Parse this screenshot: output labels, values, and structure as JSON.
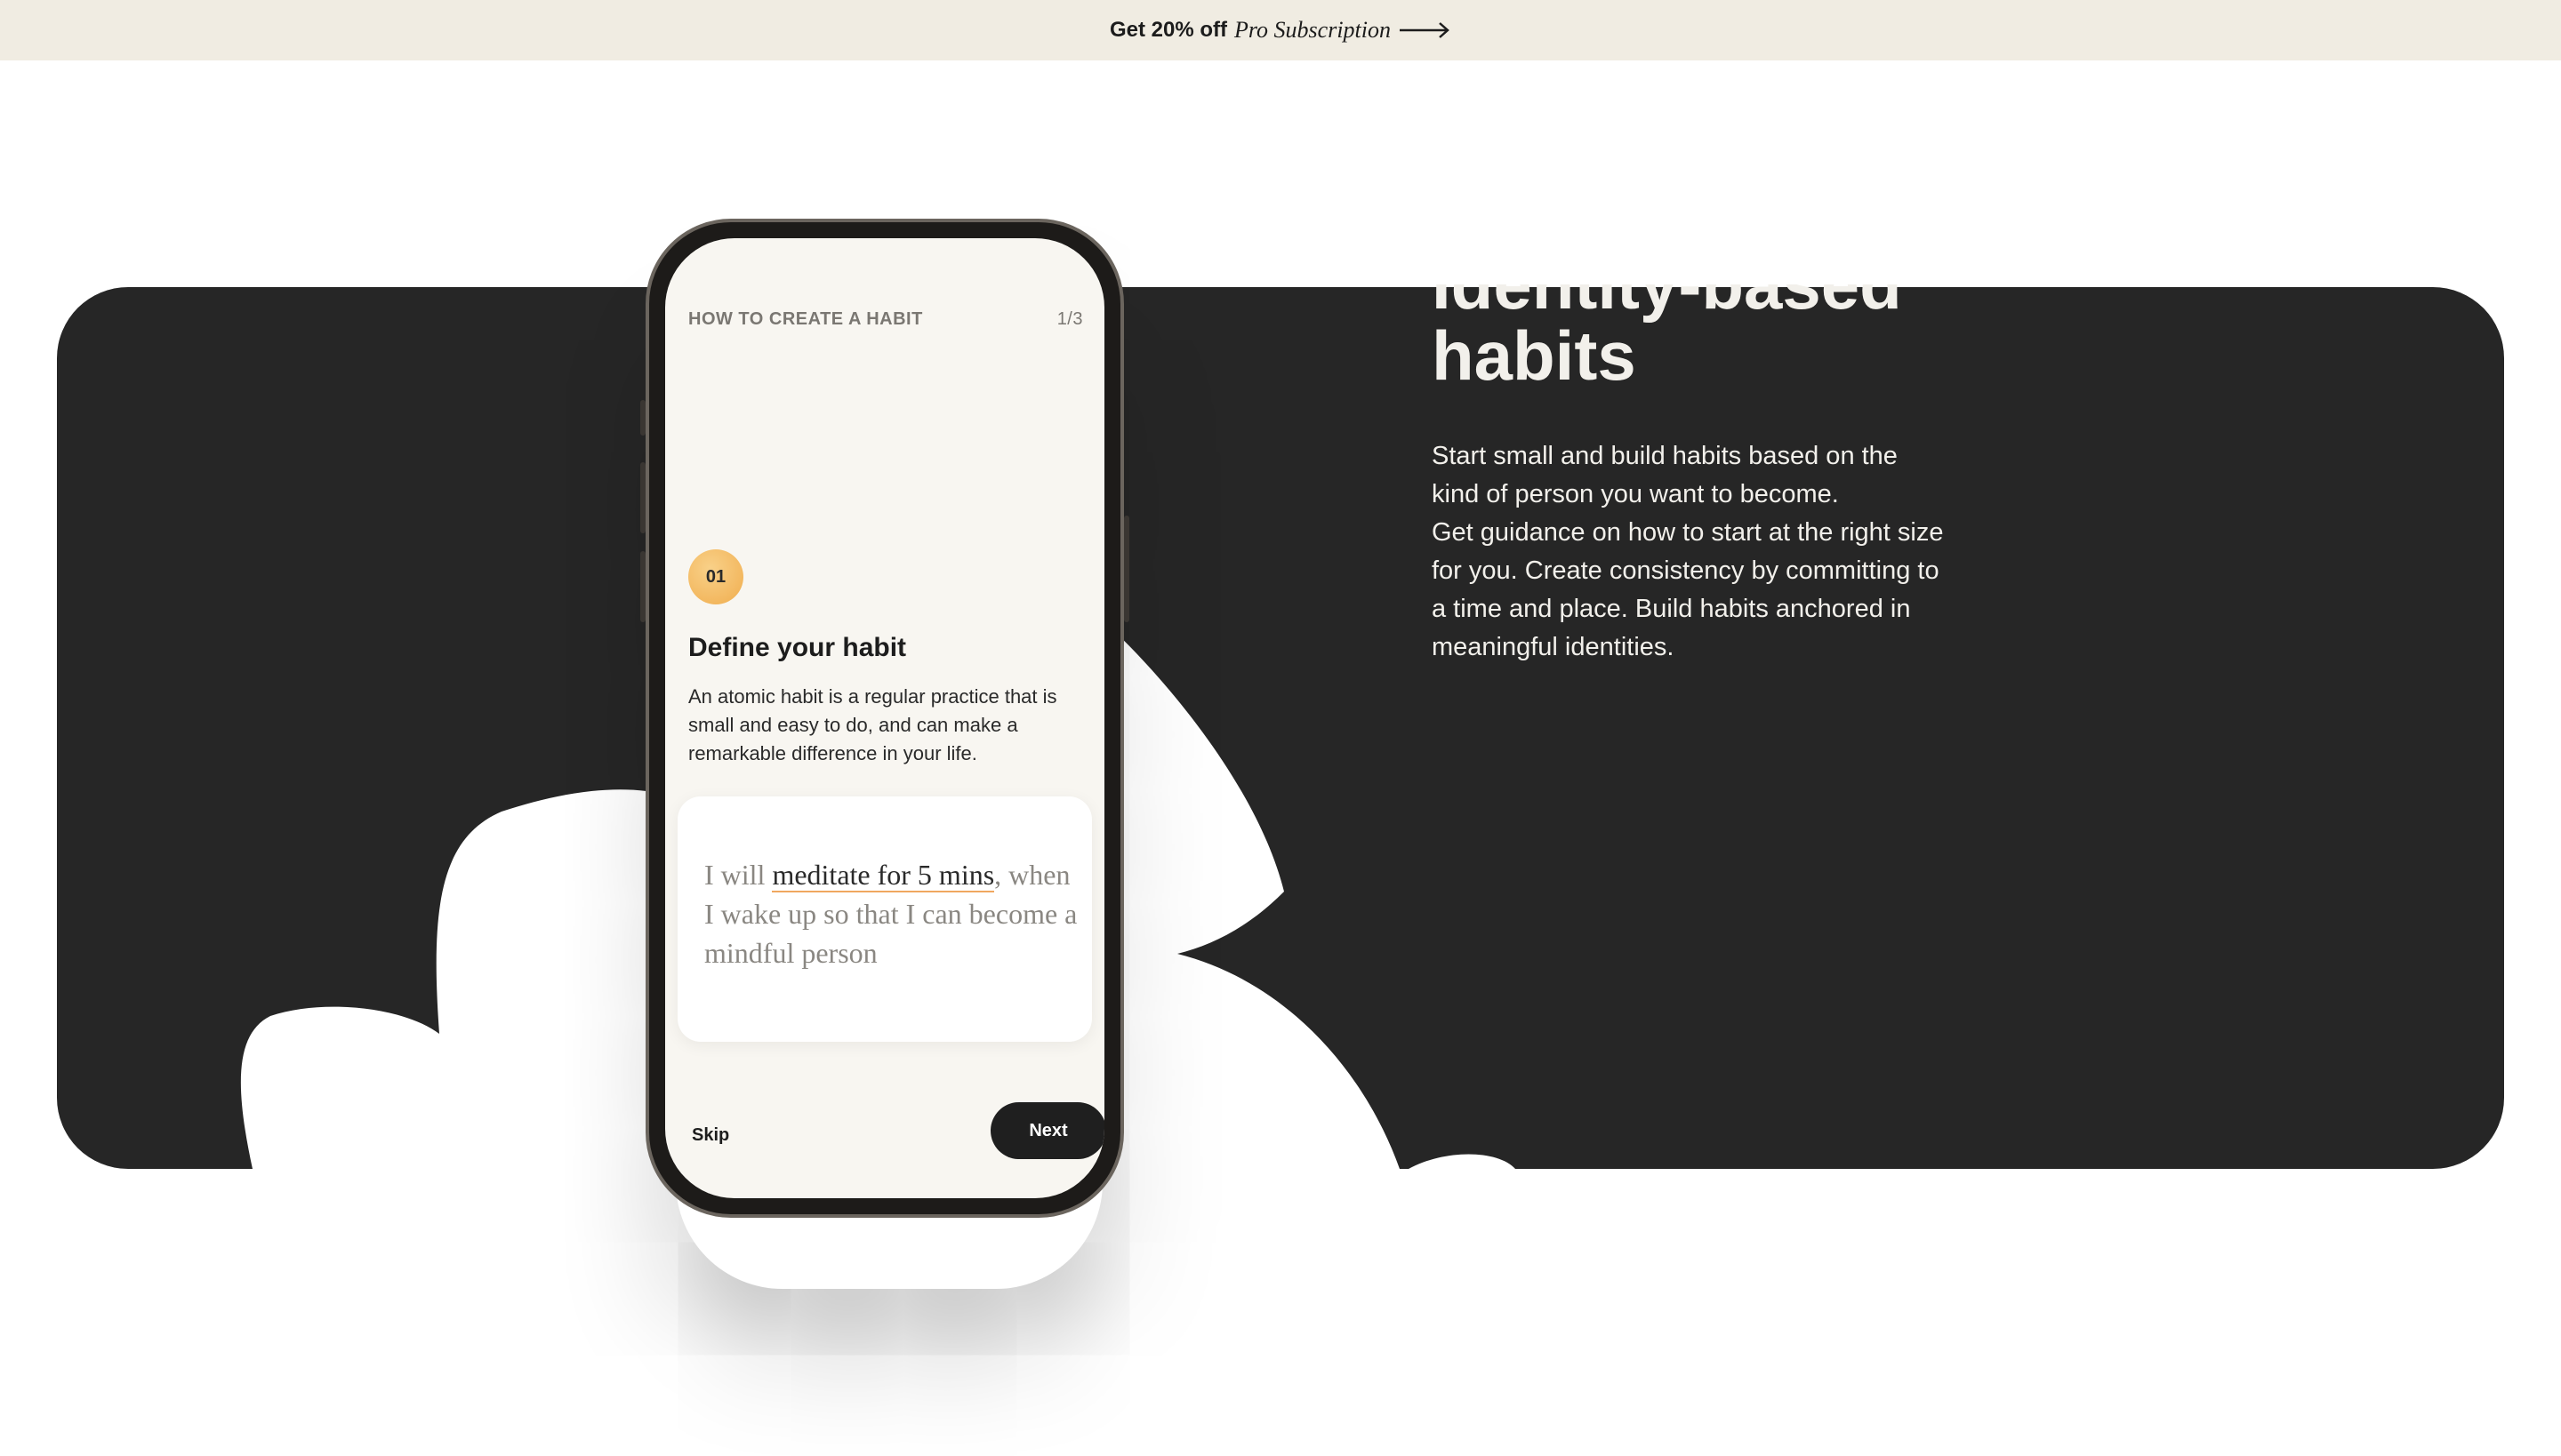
{
  "banner": {
    "prefix": "Get 20% off",
    "italic": "Pro Subscription",
    "icon": "arrow-right-icon"
  },
  "feature": {
    "headline_line1": "Identity-based",
    "headline_line2": "habits",
    "body_p1": "Start small and build habits based on the kind of person you want to become.",
    "body_p2": "Get guidance on how to start at the right size for you. Create consistency by committing to a time and place. Build habits anchored in meaningful identities."
  },
  "phone": {
    "header_title": "HOW TO CREATE A HABIT",
    "step_count": "1/3",
    "step_number": "01",
    "step_title": "Define your habit",
    "step_description": "An atomic habit is a regular practice that is small and easy to do, and can make a remarkable difference in your life.",
    "quote_prefix": "I will ",
    "quote_highlight": "meditate for 5 mins",
    "quote_suffix": ", when I wake up so that I can become a mindful person",
    "skip_label": "Skip",
    "next_label": "Next"
  },
  "colors": {
    "banner_bg": "#f0ece2",
    "panel_bg": "#262626",
    "accent": "#f0ad4e",
    "screen_bg": "#f8f6f1"
  }
}
